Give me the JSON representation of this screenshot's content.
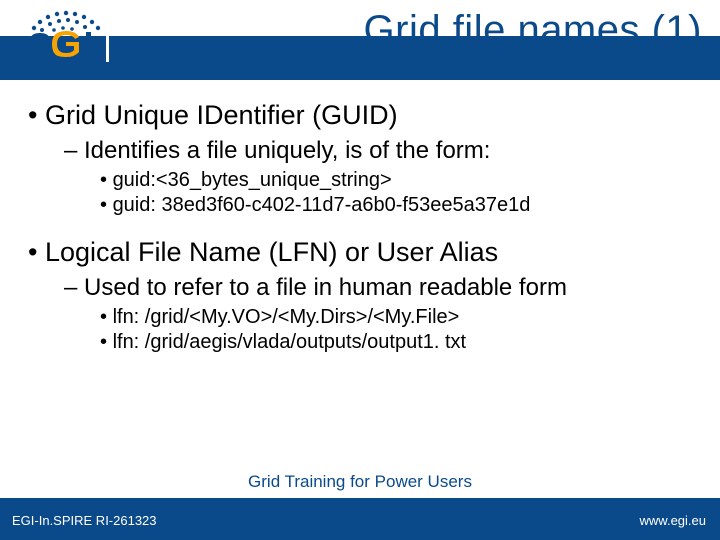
{
  "title": "Grid file names (1)",
  "body": {
    "guid": {
      "heading": "Grid Unique IDentifier (GUID)",
      "sub": "Identifies a file uniquely, is of the form:",
      "ex1": "guid:<36_bytes_unique_string>",
      "ex2": "guid: 38ed3f60-c402-11d7-a6b0-f53ee5a37e1d"
    },
    "lfn": {
      "heading": "Logical File Name (LFN) or User Alias",
      "sub": "Used to refer to a file in human readable form",
      "ex1": "lfn: /grid/<My.VO>/<My.Dirs>/<My.File>",
      "ex2": "lfn: /grid/aegis/vlada/outputs/output1. txt"
    }
  },
  "footer": {
    "left": "EGI-In.SPIRE RI-261323",
    "center": "Grid Training for Power Users",
    "right": "www.egi.eu"
  }
}
